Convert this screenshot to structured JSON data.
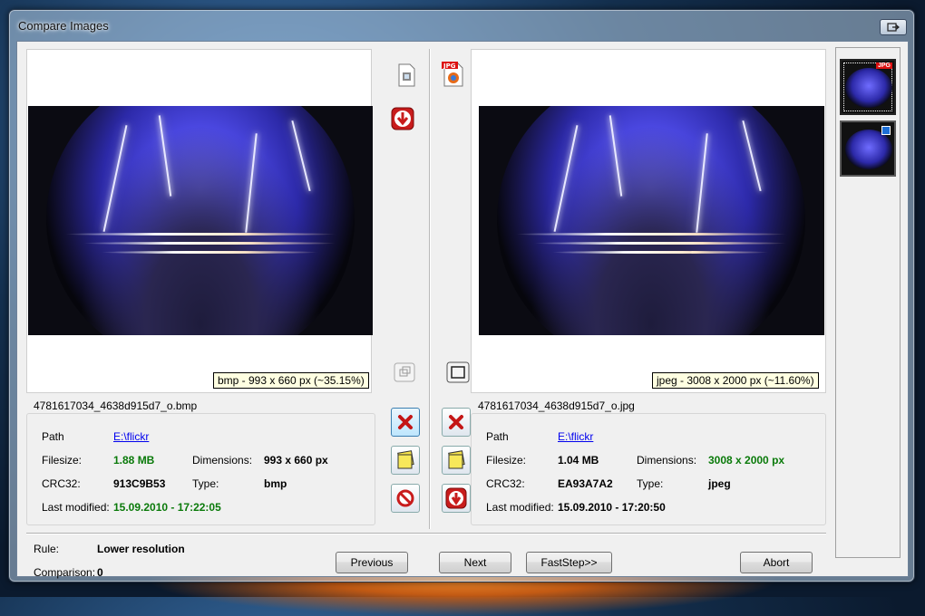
{
  "window": {
    "title": "Compare Images"
  },
  "left": {
    "caption": "bmp - 993 x 660 px (~35.15%)",
    "filename": "4781617034_4638d915d7_o.bmp",
    "path_label": "Path",
    "path_value": "E:\\flickr",
    "filesize_label": "Filesize:",
    "filesize_value": "1.88 MB",
    "dimensions_label": "Dimensions:",
    "dimensions_value": "993 x 660 px",
    "crc_label": "CRC32:",
    "crc_value": "913C9B53",
    "type_label": "Type:",
    "type_value": "bmp",
    "modified_label": "Last modified:",
    "modified_value": "15.09.2010 - 17:22:05"
  },
  "right": {
    "caption": "jpeg - 3008 x 2000 px (~11.60%)",
    "filename": "4781617034_4638d915d7_o.jpg",
    "path_label": "Path",
    "path_value": "E:\\flickr",
    "filesize_label": "Filesize:",
    "filesize_value": "1.04 MB",
    "dimensions_label": "Dimensions:",
    "dimensions_value": "3008 x 2000 px",
    "crc_label": "CRC32:",
    "crc_value": "EA93A7A2",
    "type_label": "Type:",
    "type_value": "jpeg",
    "modified_label": "Last modified:",
    "modified_value": "15.09.2010 - 17:20:50"
  },
  "toolbar": {
    "left_format_badge": "",
    "right_format_badge": "JPG"
  },
  "thumbnails": {
    "jpg_badge": "JPG"
  },
  "footer": {
    "rule_label": "Rule:",
    "rule_value": "Lower resolution",
    "comparison_label": "Comparison:",
    "comparison_value": "0",
    "previous_button": "Previous",
    "next_button": "Next",
    "faststep_button": "FastStep>>",
    "abort_button": "Abort"
  },
  "colors": {
    "highlight_green": "#0a7a0a",
    "link_blue": "#0000ee",
    "caption_bg": "#ffffe1"
  }
}
